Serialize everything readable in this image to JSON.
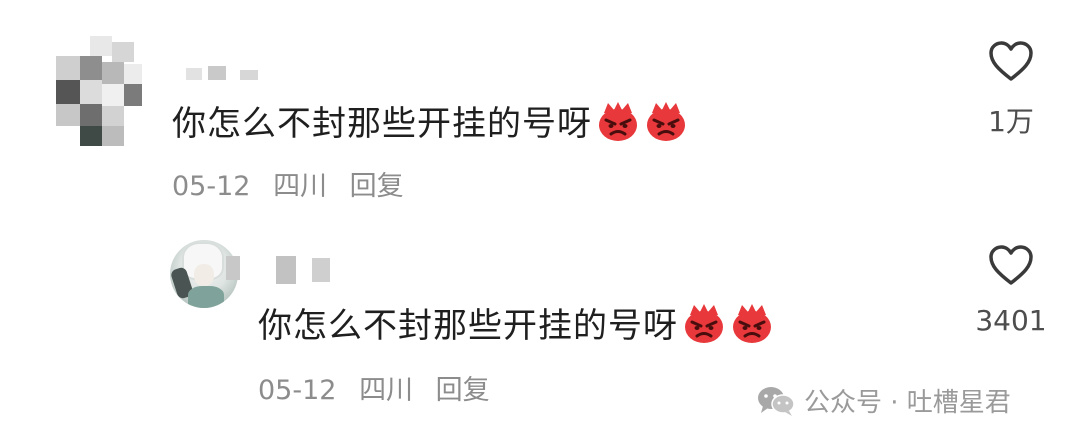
{
  "comments": [
    {
      "text": "你怎么不封那些开挂的号呀",
      "emoji": [
        "angry-face-emoji",
        "angry-face-emoji"
      ],
      "date": "05-12",
      "location": "四川",
      "reply_label": "回复",
      "likes": "1万"
    },
    {
      "text": "你怎么不封那些开挂的号呀",
      "emoji": [
        "angry-face-emoji",
        "angry-face-emoji"
      ],
      "date": "05-12",
      "location": "四川",
      "reply_label": "回复",
      "likes": "3401"
    }
  ],
  "watermark": {
    "text": "公众号 · 吐槽星君",
    "icon": "wechat-icon"
  },
  "colors": {
    "text": "#1f1f1f",
    "meta": "#8c8c8c",
    "emoji_red": "#e8383b"
  }
}
